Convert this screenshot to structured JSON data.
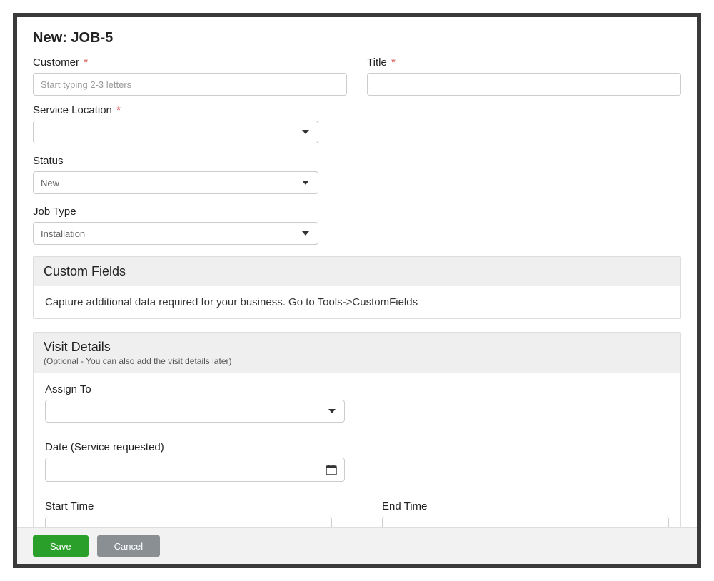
{
  "page": {
    "title": "New: JOB-5"
  },
  "fields": {
    "customer": {
      "label": "Customer",
      "required": true,
      "placeholder": "Start typing 2-3 letters"
    },
    "title": {
      "label": "Title",
      "required": true,
      "value": ""
    },
    "service_location": {
      "label": "Service Location",
      "required": true,
      "value": ""
    },
    "status": {
      "label": "Status",
      "value": "New"
    },
    "job_type": {
      "label": "Job Type",
      "value": "Installation"
    }
  },
  "custom_fields": {
    "heading": "Custom Fields",
    "hint": "Capture additional data required for your business. Go to Tools->CustomFields"
  },
  "visit": {
    "heading": "Visit Details",
    "subtitle": "(Optional - You can also add the visit details later)",
    "assign_to": {
      "label": "Assign To",
      "value": ""
    },
    "date": {
      "label": "Date (Service requested)",
      "value": ""
    },
    "start_time": {
      "label": "Start Time",
      "value": ""
    },
    "end_time": {
      "label": "End Time",
      "value": ""
    }
  },
  "footer": {
    "save": "Save",
    "cancel": "Cancel"
  },
  "glyph": {
    "asterisk": "*"
  }
}
